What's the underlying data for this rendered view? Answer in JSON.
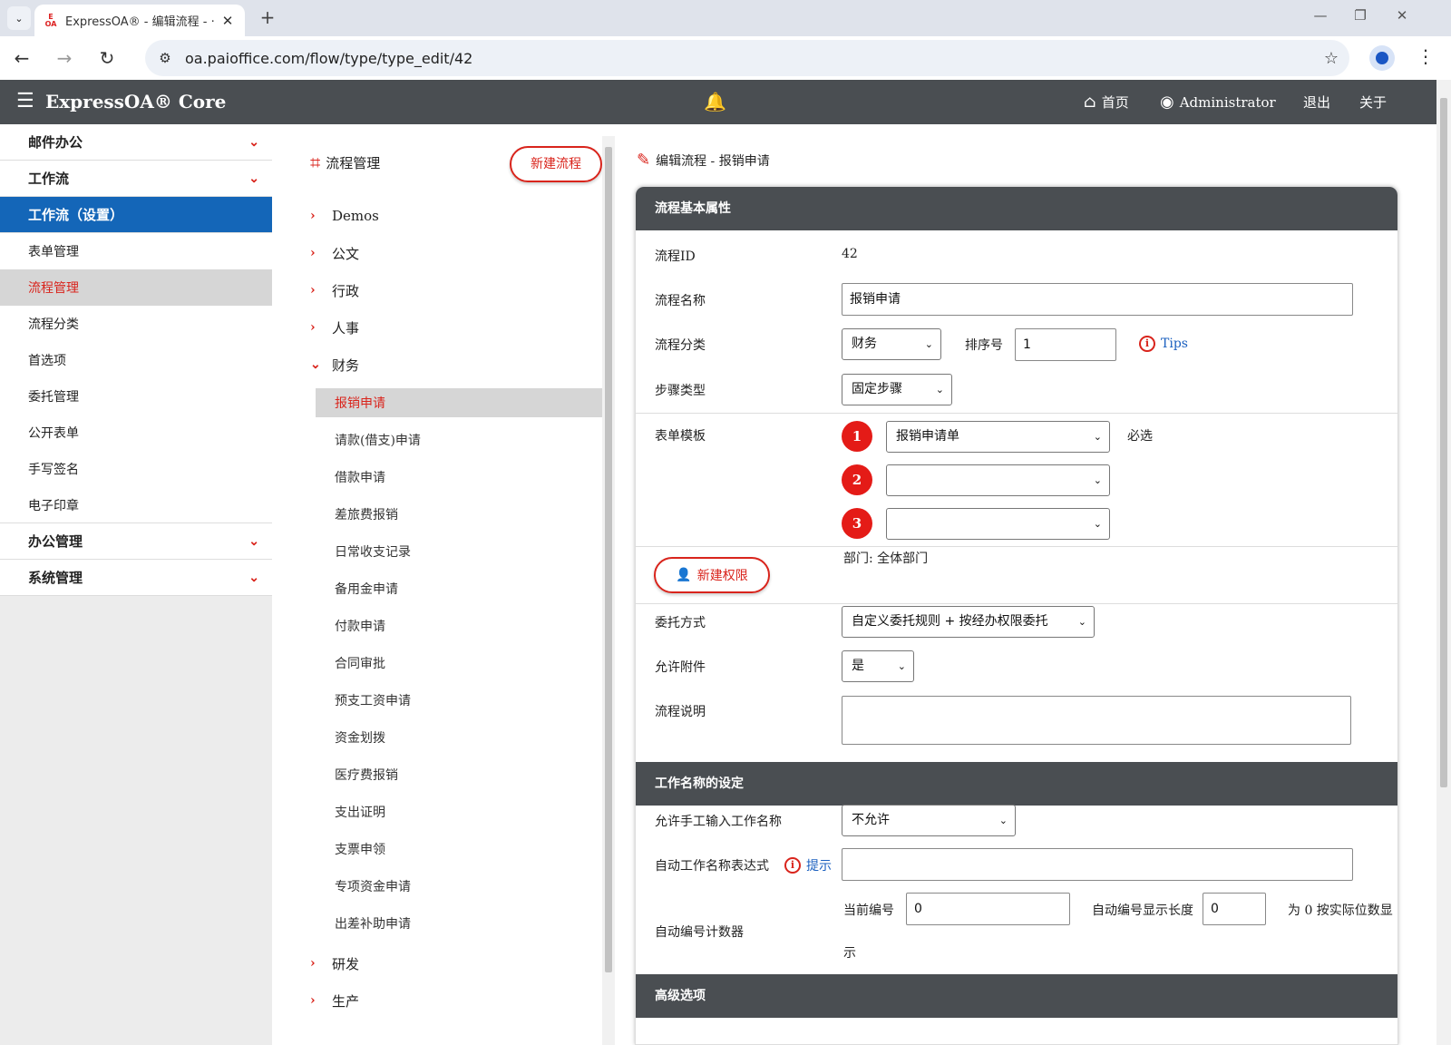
{
  "browser": {
    "tab_title": "ExpressOA® - 编辑流程 - ‧",
    "favicon_text": "E OA",
    "url": "oa.paioffice.com/flow/type/type_edit/42"
  },
  "header": {
    "brand": "ExpressOA® Core",
    "home": "首页",
    "user": "Administrator",
    "logout": "退出",
    "about": "关于"
  },
  "sidebar": {
    "mail": "邮件办公",
    "workflow": "工作流",
    "workflow_settings": "工作流（设置）",
    "items": [
      "表单管理",
      "流程管理",
      "流程分类",
      "首选项",
      "委托管理",
      "公开表单",
      "手写签名",
      "电子印章"
    ],
    "office": "办公管理",
    "system": "系统管理"
  },
  "tree": {
    "title": "流程管理",
    "new_button": "新建流程",
    "nodes_top": [
      "Demos",
      "公文",
      "行政",
      "人事"
    ],
    "open_node": "财务",
    "leaves": [
      "报销申请",
      "请款(借支)申请",
      "借款申请",
      "差旅费报销",
      "日常收支记录",
      "备用金申请",
      "付款申请",
      "合同审批",
      "预支工资申请",
      "资金划拨",
      "医疗费报销",
      "支出证明",
      "支票申领",
      "专项资金申请",
      "出差补助申请"
    ],
    "nodes_bottom": [
      "研发",
      "生产"
    ]
  },
  "main": {
    "title": "编辑流程 - 报销申请",
    "section1": "流程基本属性",
    "flow_id_label": "流程ID",
    "flow_id": "42",
    "flow_name_label": "流程名称",
    "flow_name": "报销申请",
    "category_label": "流程分类",
    "category": "财务",
    "order_label": "排序号",
    "order": "1",
    "tips": "Tips",
    "step_type_label": "步骤类型",
    "step_type": "固定步骤",
    "form_tpl_label": "表单模板",
    "form_tpl_1": "报销申请单",
    "required": "必选",
    "badges": [
      "1",
      "2",
      "3"
    ],
    "perm_button": "新建权限",
    "dept": "部门:  全体部门",
    "delegate_label": "委托方式",
    "delegate": "自定义委托规则 + 按经办权限委托",
    "attach_label": "允许附件",
    "attach": "是",
    "desc_label": "流程说明",
    "section2": "工作名称的设定",
    "manual_name_label": "允许手工输入工作名称",
    "manual_name": "不允许",
    "auto_expr_label": "自动工作名称表达式",
    "hint": "提示",
    "counter_label": "自动编号计数器",
    "current_no_label": "当前编号",
    "current_no": "0",
    "disp_len_label": "自动编号显示长度",
    "disp_len": "0",
    "zero_note_1": "为 0 按实际位数显",
    "zero_note_2": "示",
    "section3": "高级选项"
  }
}
